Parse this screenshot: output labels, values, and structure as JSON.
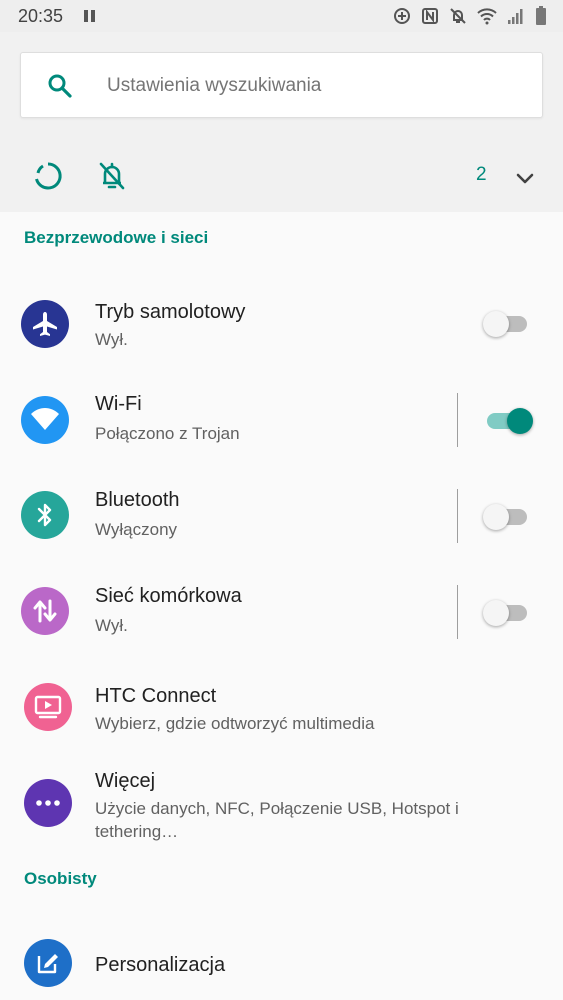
{
  "status_bar": {
    "time": "20:35",
    "icons": [
      "pause-icon",
      "data-saver-icon",
      "nfc-icon",
      "bell-off-icon",
      "wifi-icon",
      "signal-icon",
      "battery-icon"
    ]
  },
  "search": {
    "placeholder": "Ustawienia wyszukiwania"
  },
  "suggestions": {
    "count": "2"
  },
  "sections": {
    "wireless": {
      "header": "Bezprzewodowe i sieci",
      "items": [
        {
          "title": "Tryb samolotowy",
          "subtitle": "Wył.",
          "icon": "airplane-icon",
          "color": "#283593",
          "toggle": false
        },
        {
          "title": "Wi-Fi",
          "subtitle": "Połączono z Trojan",
          "icon": "wifi-icon",
          "color": "#2196f3",
          "toggle": true
        },
        {
          "title": "Bluetooth",
          "subtitle": "Wyłączony",
          "icon": "bluetooth-icon",
          "color": "#26a69a",
          "toggle": false
        },
        {
          "title": "Sieć komórkowa",
          "subtitle": "Wył.",
          "icon": "mobile-data-icon",
          "color": "#ba68c8",
          "toggle": false
        },
        {
          "title": "HTC Connect",
          "subtitle": "Wybierz, gdzie odtworzyć multimedia",
          "icon": "cast-icon",
          "color": "#f06292"
        },
        {
          "title": "Więcej",
          "subtitle": "Użycie danych, NFC, Połączenie USB, Hotspot i tethering…",
          "icon": "more-icon",
          "color": "#5e35b1"
        }
      ]
    },
    "personal": {
      "header": "Osobisty",
      "items": [
        {
          "title": "Personalizacja",
          "icon": "personalize-icon",
          "color": "#1e6fc8"
        }
      ]
    }
  },
  "colors": {
    "accent": "#00897b"
  }
}
